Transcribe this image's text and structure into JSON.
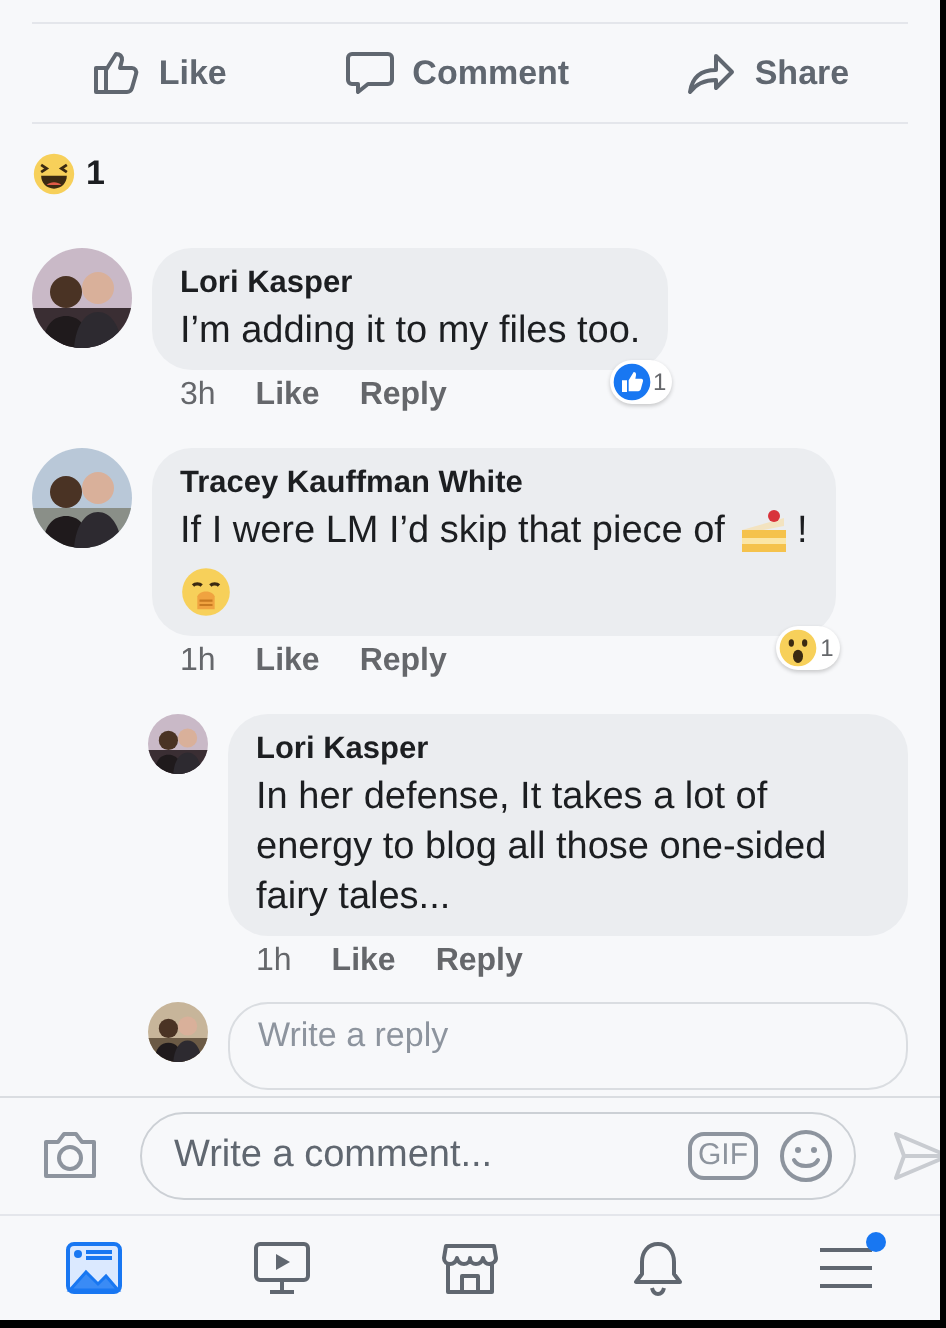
{
  "post_actions": [
    {
      "kind": "like",
      "label": "Like"
    },
    {
      "kind": "comment",
      "label": "Comment"
    },
    {
      "kind": "share",
      "label": "Share"
    }
  ],
  "reaction_summary": {
    "kind": "haha",
    "count": "1"
  },
  "comments": [
    {
      "author": "Lori Kasper",
      "body": [
        {
          "kind": "text",
          "text": "I’m adding it to my files too."
        }
      ],
      "time": "3h",
      "like": "Like",
      "reply": "Reply",
      "reaction": {
        "kind": "like",
        "count": "1"
      }
    },
    {
      "author": "Tracey Kauffman White",
      "body": [
        {
          "kind": "text",
          "text": "If I were LM I’d skip that piece of"
        },
        {
          "kind": "cake"
        },
        {
          "kind": "text",
          "text": "!"
        },
        {
          "kind": "break"
        },
        {
          "kind": "shush"
        }
      ],
      "time": "1h",
      "like": "Like",
      "reply": "Reply",
      "reaction": {
        "kind": "wow",
        "count": "1"
      },
      "replies": [
        {
          "author": "Lori Kasper",
          "body": [
            {
              "kind": "text",
              "text": "In her defense, It takes a lot of energy to blog all those one-sided fairy tales..."
            }
          ],
          "time": "1h",
          "like": "Like",
          "reply": "Reply"
        }
      ]
    }
  ],
  "reply_field": {
    "placeholder": "Write a reply"
  },
  "composer": {
    "placeholder": "Write a comment...",
    "gif": "GIF"
  },
  "tab_bar": [
    {
      "kind": "news",
      "selected": true,
      "dot": false
    },
    {
      "kind": "watch",
      "selected": false,
      "dot": false
    },
    {
      "kind": "marketplace",
      "selected": false,
      "dot": false
    },
    {
      "kind": "notifications",
      "selected": false,
      "dot": false
    },
    {
      "kind": "menu",
      "selected": false,
      "dot": true
    }
  ]
}
